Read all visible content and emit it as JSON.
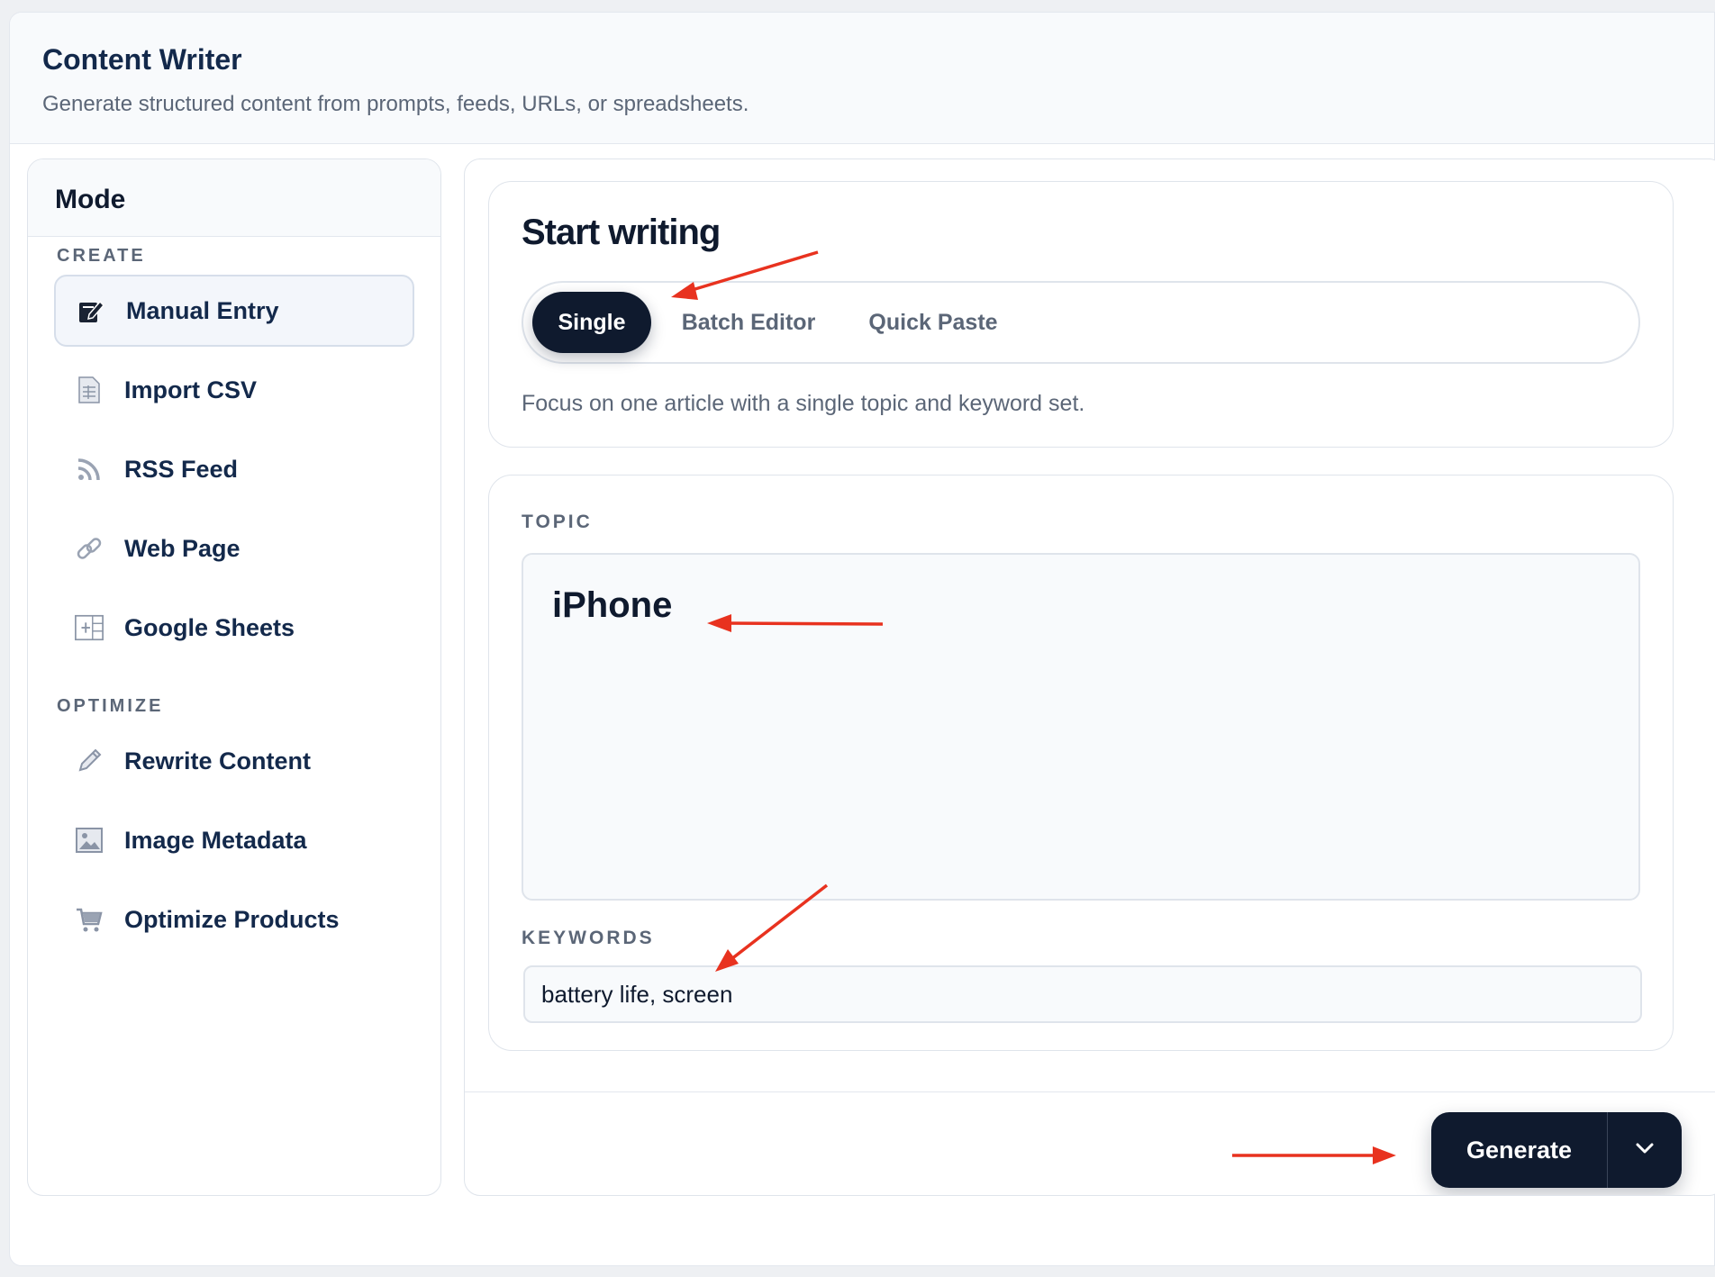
{
  "header": {
    "title": "Content Writer",
    "subtitle": "Generate structured content from prompts, feeds, URLs, or spreadsheets."
  },
  "sidebar": {
    "title": "Mode",
    "sections": [
      {
        "label": "CREATE",
        "items": [
          {
            "label": "Manual Entry",
            "icon": "edit-note-icon",
            "active": true
          },
          {
            "label": "Import CSV",
            "icon": "spreadsheet-doc-icon",
            "active": false
          },
          {
            "label": "RSS Feed",
            "icon": "rss-icon",
            "active": false
          },
          {
            "label": "Web Page",
            "icon": "link-icon",
            "active": false
          },
          {
            "label": "Google Sheets",
            "icon": "grid-add-icon",
            "active": false
          }
        ]
      },
      {
        "label": "OPTIMIZE",
        "items": [
          {
            "label": "Rewrite Content",
            "icon": "pencil-icon",
            "active": false
          },
          {
            "label": "Image Metadata",
            "icon": "image-icon",
            "active": false
          },
          {
            "label": "Optimize Products",
            "icon": "cart-icon",
            "active": false
          }
        ]
      }
    ]
  },
  "start": {
    "title": "Start writing",
    "tabs": [
      {
        "label": "Single",
        "active": true
      },
      {
        "label": "Batch Editor",
        "active": false
      },
      {
        "label": "Quick Paste",
        "active": false
      }
    ],
    "description": "Focus on one article with a single topic and keyword set."
  },
  "form": {
    "topic_label": "TOPIC",
    "topic_value": "iPhone",
    "keywords_label": "KEYWORDS",
    "keywords_value": "battery life, screen"
  },
  "actions": {
    "generate_label": "Generate"
  },
  "colors": {
    "primary": "#0f1a2e",
    "annotation": "#e8321f",
    "muted_text": "#5b6677"
  }
}
